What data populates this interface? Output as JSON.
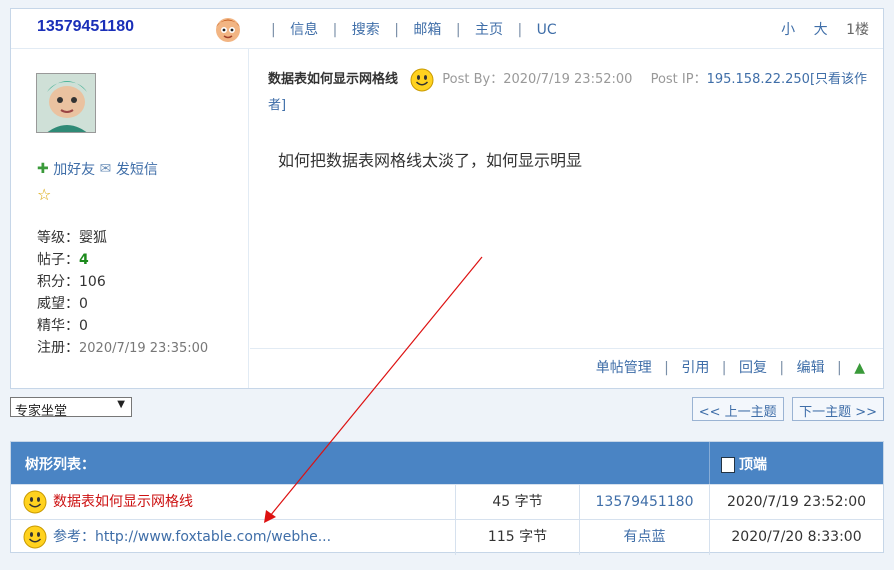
{
  "header": {
    "username": "13579451180",
    "nav": [
      "信息",
      "搜索",
      "邮箱",
      "主页",
      "UC"
    ],
    "font_small": "小",
    "font_large": "大",
    "floor": "1楼"
  },
  "profile": {
    "add_friend": "加好友",
    "send_message": "发短信",
    "stats": {
      "level_label": "等级：",
      "level_value": "婴狐",
      "posts_label": "帖子：",
      "posts_value": "4",
      "points_label": "积分：",
      "points_value": "106",
      "prestige_label": "威望：",
      "prestige_value": "0",
      "essence_label": "精华：",
      "essence_value": "0",
      "registered_label": "注册：",
      "registered_value": "2020/7/19 23:35:00"
    }
  },
  "post": {
    "title": "数据表如何显示网格线",
    "post_by": "Post By：2020/7/19 23:52:00",
    "post_ip_label": "Post IP：",
    "post_ip": "195.158.22.250",
    "view_author": "[只看该作者]",
    "body": "如何把数据表网格线太淡了，如何显示明显",
    "tools": [
      "单帖管理",
      "引用",
      "回复",
      "编辑"
    ]
  },
  "forum_select": {
    "value": "专家坐堂"
  },
  "topic_nav": {
    "prev": "<< 上一主题",
    "next": "下一主题 >>"
  },
  "tree": {
    "title": "树形列表：",
    "top": "顶端",
    "rows": [
      {
        "title": "数据表如何显示网格线",
        "size": "45 字节",
        "author": "13579451180",
        "time": "2020/7/19 23:52:00"
      },
      {
        "title": "参考：http://www.foxtable.com/webhe...",
        "size": "115 字节",
        "author": "有点蓝",
        "time": "2020/7/20 8:33:00"
      }
    ]
  },
  "colors": {
    "accent": "#4a84c4",
    "link": "#3f6ea8",
    "username": "#1a2fb8",
    "annotation_arrow": "#d11"
  }
}
